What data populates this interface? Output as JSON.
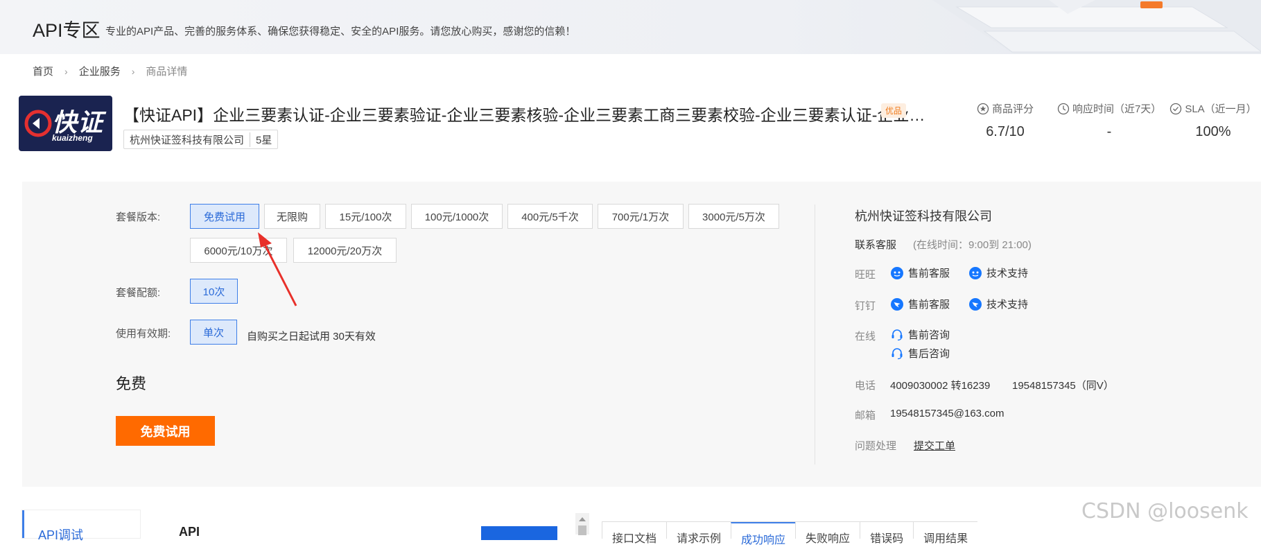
{
  "banner": {
    "title": "API专区",
    "subtitle": "专业的API产品、完善的服务体系、确保您获得稳定、安全的API服务。请您放心购买，感谢您的信赖！"
  },
  "breadcrumb": [
    "首页",
    "企业服务",
    "商品详情"
  ],
  "product": {
    "logo_text": "快证",
    "logo_subtext": "kuaizheng",
    "title": "【快证API】企业三要素认证-企业三要素验证-企业三要素核验-企业三要素工商三要素校验-企业三要素认证-企业…",
    "badge": "优品",
    "vendor": "杭州快证签科技有限公司",
    "vendor_rating": "5星"
  },
  "metrics": [
    {
      "label": "商品评分",
      "value": "6.7/10",
      "icon": "star-circle-icon"
    },
    {
      "label": "响应时间（近7天）",
      "value": "-",
      "icon": "clock-icon"
    },
    {
      "label": "SLA（近一月）",
      "value": "100%",
      "icon": "check-circle-icon"
    }
  ],
  "plan": {
    "version_label": "套餐版本:",
    "versions": [
      "免费试用",
      "无限购",
      "15元/100次",
      "100元/1000次",
      "400元/5千次",
      "700元/1万次",
      "3000元/5万次",
      "6000元/10万次",
      "12000元/20万次"
    ],
    "selected_version": "免费试用",
    "quota_label": "套餐配额:",
    "quota": "10次",
    "validity_label": "使用有效期:",
    "validity": "单次",
    "validity_note": "自购买之日起试用 30天有效",
    "price": "免费",
    "buy_label": "免费试用"
  },
  "support": {
    "company": "杭州快证签科技有限公司",
    "cs_label": "联系客服",
    "cs_hours": "(在线时间：9:00到 21:00)",
    "wangwang_label": "旺旺",
    "dingding_label": "钉钉",
    "online_label": "在线",
    "presale": "售前客服",
    "tech": "技术支持",
    "presale_consult": "售前咨询",
    "aftersale_consult": "售后咨询",
    "phone_label": "电话",
    "phone": "4009030002 转16239",
    "phone2": "19548157345（同V）",
    "email_label": "邮箱",
    "email": "19548157345@163.com",
    "issue_label": "问题处理",
    "issue_link": "提交工单"
  },
  "bottom": {
    "side_tab": "API调试",
    "api_heading": "API",
    "doc_tabs": [
      "接口文档",
      "请求示例",
      "成功响应",
      "失败响应",
      "错误码",
      "调用结果"
    ]
  },
  "watermark": "CSDN @loosenk",
  "colors": {
    "accent": "#3d7ee8",
    "buy": "#ff6a00",
    "badge": "#f07c1e"
  }
}
